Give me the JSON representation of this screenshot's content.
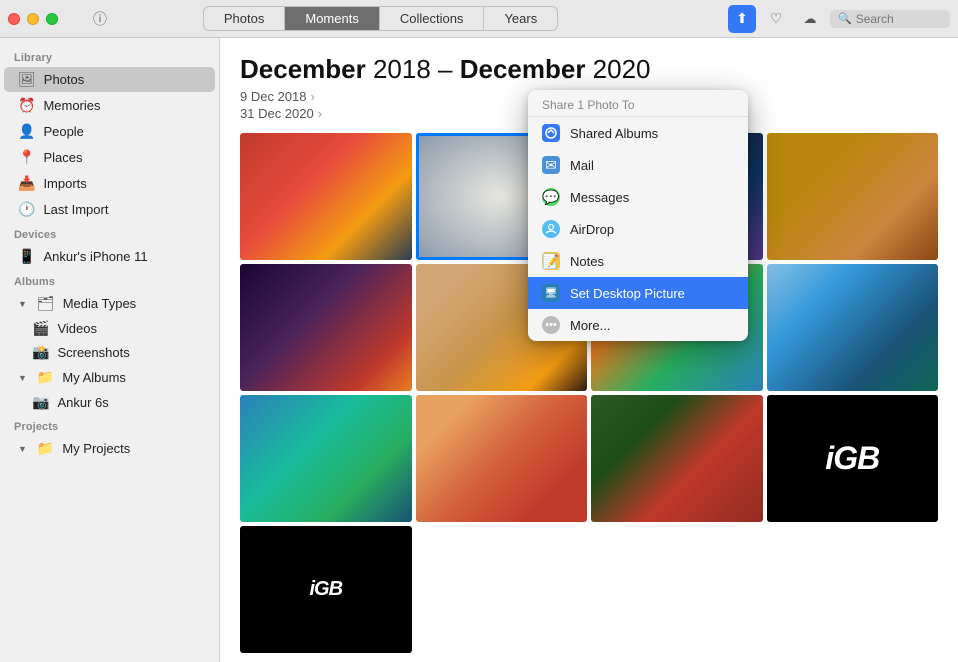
{
  "titlebar": {
    "tabs": [
      {
        "id": "photos",
        "label": "Photos",
        "active": false
      },
      {
        "id": "moments",
        "label": "Moments",
        "active": true
      },
      {
        "id": "collections",
        "label": "Collections",
        "active": false
      },
      {
        "id": "years",
        "label": "Years",
        "active": false
      }
    ],
    "search_placeholder": "Search"
  },
  "sidebar": {
    "library_label": "Library",
    "library_items": [
      {
        "id": "photos",
        "label": "Photos",
        "icon": "🖼"
      },
      {
        "id": "memories",
        "label": "Memories",
        "icon": "⏰"
      },
      {
        "id": "people",
        "label": "People",
        "icon": "👤"
      },
      {
        "id": "places",
        "label": "Places",
        "icon": "📍"
      },
      {
        "id": "imports",
        "label": "Imports",
        "icon": "📥"
      },
      {
        "id": "last-import",
        "label": "Last Import",
        "icon": "🕐"
      }
    ],
    "devices_label": "Devices",
    "devices_items": [
      {
        "id": "iphone",
        "label": "Ankur's iPhone 11",
        "icon": "📱"
      }
    ],
    "albums_label": "Albums",
    "albums_groups": [
      {
        "id": "media-types",
        "label": "Media Types",
        "expanded": true,
        "items": [
          {
            "id": "videos",
            "label": "Videos",
            "icon": "🎬"
          },
          {
            "id": "screenshots",
            "label": "Screenshots",
            "icon": "📸"
          }
        ]
      },
      {
        "id": "my-albums",
        "label": "My Albums",
        "expanded": true,
        "items": [
          {
            "id": "ankur6s",
            "label": "Ankur 6s",
            "icon": "📁"
          }
        ]
      }
    ],
    "projects_label": "Projects",
    "projects_groups": [
      {
        "id": "my-projects",
        "label": "My Projects",
        "expanded": true,
        "items": []
      }
    ]
  },
  "content": {
    "date_range_start_bold": "December",
    "date_range_start_light": " 2018 – ",
    "date_range_end_bold": "December",
    "date_range_end_light": " 2020",
    "date1": "9 Dec 2018",
    "date2": "31 Dec 2020"
  },
  "dropdown": {
    "header": "Share 1 Photo To",
    "items": [
      {
        "id": "shared-albums",
        "label": "Shared Albums",
        "icon_type": "shared-albums"
      },
      {
        "id": "mail",
        "label": "Mail",
        "icon_type": "mail"
      },
      {
        "id": "messages",
        "label": "Messages",
        "icon_type": "messages"
      },
      {
        "id": "airdrop",
        "label": "AirDrop",
        "icon_type": "airdrop"
      },
      {
        "id": "notes",
        "label": "Notes",
        "icon_type": "notes"
      },
      {
        "id": "set-desktop",
        "label": "Set Desktop Picture",
        "icon_type": "desktop",
        "highlighted": true
      },
      {
        "id": "more",
        "label": "More...",
        "icon_type": "more"
      }
    ]
  },
  "photos": {
    "igb_text": "iGB"
  }
}
